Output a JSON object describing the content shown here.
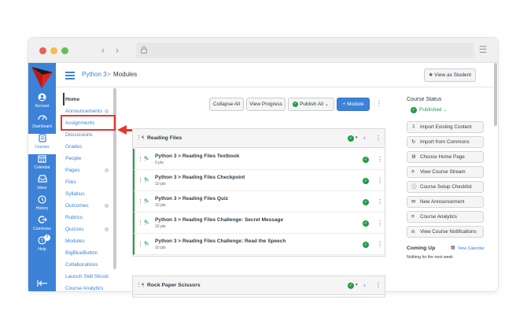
{
  "colors": {
    "accent": "#3b82d8",
    "success": "#1f9e44",
    "annotation": "#e33a2e",
    "text": "#2d3b45"
  },
  "global_nav": [
    {
      "label": "Account",
      "icon": "account-icon"
    },
    {
      "label": "Dashboard",
      "icon": "dashboard-icon"
    },
    {
      "label": "Courses",
      "icon": "courses-icon"
    },
    {
      "label": "Calendar",
      "icon": "calendar-icon"
    },
    {
      "label": "Inbox",
      "icon": "inbox-icon"
    },
    {
      "label": "History",
      "icon": "history-icon"
    },
    {
      "label": "Commons",
      "icon": "commons-icon"
    },
    {
      "label": "Help",
      "icon": "help-icon"
    }
  ],
  "help_badge": "7",
  "breadcrumb": {
    "course": "Python 3",
    "separator": ">",
    "page": "Modules"
  },
  "header": {
    "view_as_student": "View as Student"
  },
  "course_nav": [
    "Home",
    "Announcements",
    "Assignments",
    "Discussions",
    "Grades",
    "People",
    "Pages",
    "Files",
    "Syllabus",
    "Outcomes",
    "Rubrics",
    "Quizzes",
    "Modules",
    "BigBlueButton",
    "Collaborations",
    "Launch Skill Struck",
    "Course Analytics"
  ],
  "toolbar": {
    "collapse_all": "Collapse All",
    "view_progress": "View Progress",
    "publish_all": "Publish All",
    "add_module": "+ Module"
  },
  "modules": [
    {
      "title": "Reading Files",
      "items": [
        {
          "title": "Python 3 > Reading Files Textbook",
          "points": "0 pts"
        },
        {
          "title": "Python 3 > Reading Files Checkpoint",
          "points": "10 pts"
        },
        {
          "title": "Python 3 > Reading Files Quiz",
          "points": "10 pts"
        },
        {
          "title": "Python 3 > Reading Files Challenge: Secret Message",
          "points": "10 pts"
        },
        {
          "title": "Python 3 > Reading Files Challenge: Read the Speech",
          "points": "10 pts"
        }
      ]
    },
    {
      "title": "Rock Paper Scissors",
      "items": []
    }
  ],
  "course_status": {
    "title": "Course Status",
    "published": "Published",
    "actions": [
      "Import Existing Content",
      "Import from Commons",
      "Choose Home Page",
      "View Course Stream",
      "Course Setup Checklist",
      "New Announcement",
      "Course Analytics",
      "View Course Notifications"
    ]
  },
  "coming_up": {
    "title": "Coming Up",
    "view_calendar": "View Calendar",
    "empty": "Nothing for the next week"
  }
}
